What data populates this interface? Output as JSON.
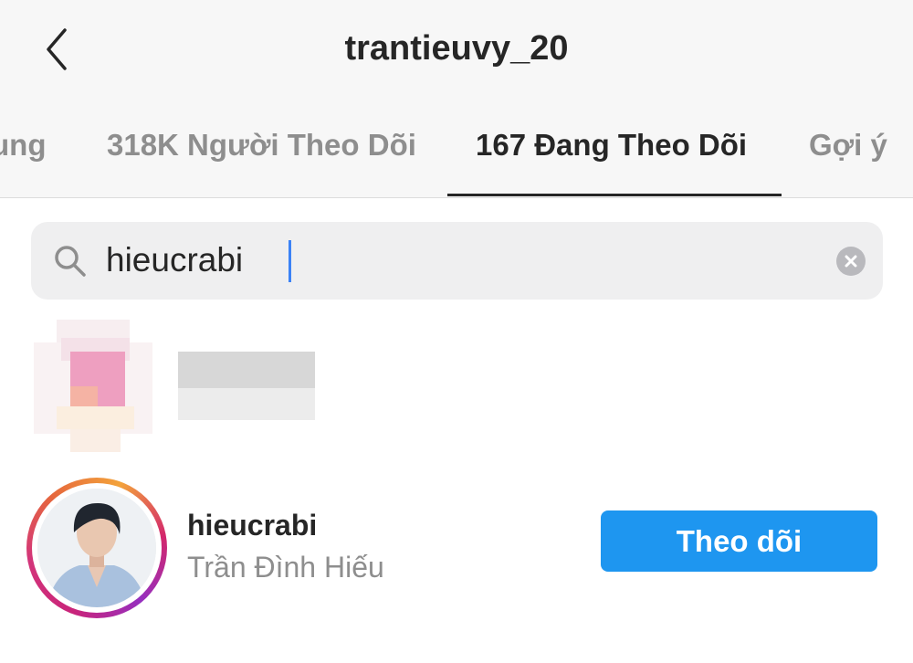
{
  "header": {
    "title": "trantieuvy_20",
    "back_icon": "chevron-left-icon"
  },
  "tabs": [
    {
      "label": "ung",
      "active": false
    },
    {
      "label": "318K Người Theo Dõi",
      "active": false
    },
    {
      "label": "167 Đang Theo Dõi",
      "active": true
    },
    {
      "label": "Gợi ý",
      "active": false
    }
  ],
  "search": {
    "value": "hieucrabi",
    "icon": "search-icon",
    "clear_icon": "clear-icon"
  },
  "results": [
    {
      "username": "hieucrabi",
      "full_name": "Trần Đình Hiếu",
      "button_label": "Theo dõi"
    }
  ],
  "colors": {
    "accent": "#1e96f0",
    "header_bg": "#f7f7f7",
    "search_bg": "#efeff0",
    "primary_text": "#262626",
    "secondary_text": "#8e8e8e"
  }
}
